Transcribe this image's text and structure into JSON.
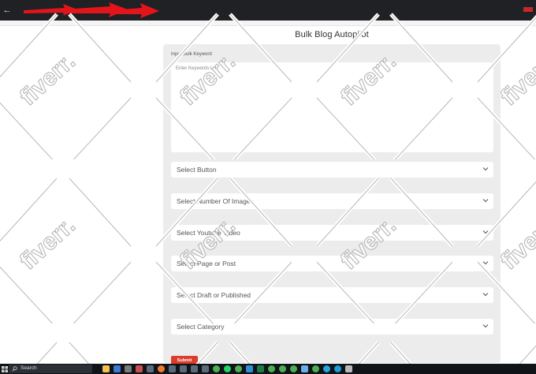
{
  "page": {
    "title": "Bulk Blog Autopilot"
  },
  "form": {
    "keyword_label": "Input Bulk Keyword",
    "keyword_placeholder": "Enter Keywords List",
    "selects": [
      {
        "label": "Select Button"
      },
      {
        "label": "Select Number Of Images"
      },
      {
        "label": "Select Youtube Video"
      },
      {
        "label": "Select Page or Post"
      },
      {
        "label": "Select Draft or Published"
      },
      {
        "label": "Select Category"
      }
    ],
    "submit_label": "Submit"
  },
  "taskbar": {
    "search_label": "Search",
    "pinned_icons": [
      "file-explorer-icon",
      "store-icon",
      "notes-icon",
      "media-icon",
      "app-icon",
      "firefox-icon",
      "app-icon",
      "app-icon",
      "app-icon",
      "app-icon",
      "chrome-icon",
      "whatsapp-icon",
      "chrome-icon",
      "vscode-icon",
      "excel-icon",
      "chrome-icon",
      "chrome-icon",
      "chrome-icon",
      "photos-icon",
      "chrome-icon",
      "telegram-icon",
      "edge-icon",
      "settings-icon"
    ]
  },
  "watermark": {
    "text": "fiverr."
  },
  "colors": {
    "topbar": "#202124",
    "panel": "#ececec",
    "submit": "#dc3d2a",
    "annotation_arrow": "#e3151b",
    "taskbar": "#101419"
  }
}
